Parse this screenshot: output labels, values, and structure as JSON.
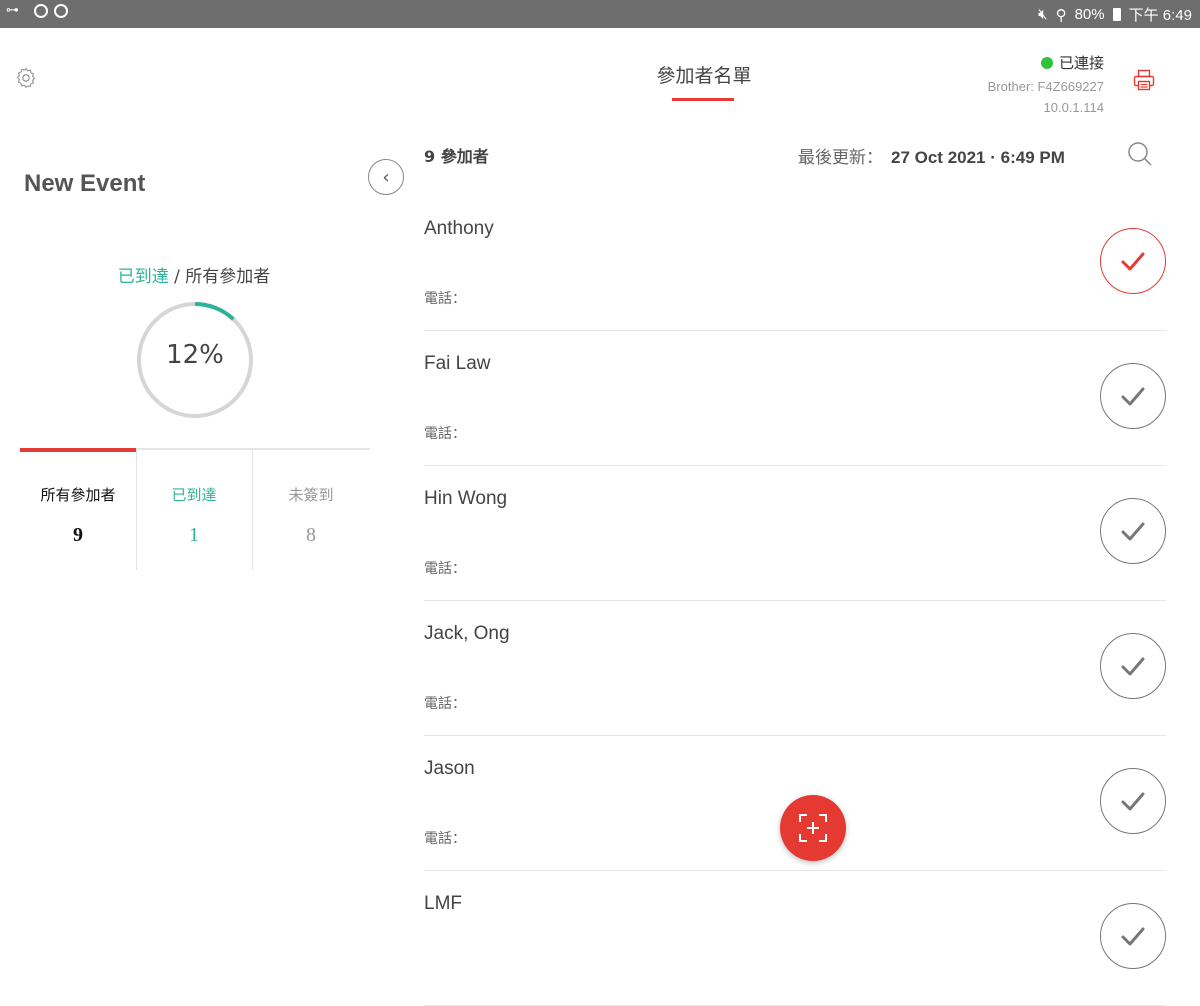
{
  "status_bar": {
    "battery": "80%",
    "time": "下午 6:49",
    "icons_left": [
      "key-icon",
      "vpn-icon",
      "minus-circle-icon"
    ],
    "icons_right": [
      "mute-icon",
      "signal-icon",
      "battery-icon"
    ]
  },
  "left_panel": {
    "event_title": "New Event",
    "ratio_label_arrived": "已到達",
    "ratio_label_sep": " / ",
    "ratio_label_all": "所有參加者",
    "progress_text": "12%",
    "progress_value": 0.12,
    "stats": [
      {
        "label": "所有參加者",
        "value": "9",
        "color": "#111111",
        "active": true
      },
      {
        "label": "已到達",
        "value": "1",
        "color": "#2bb39a",
        "active": false
      },
      {
        "label": "未簽到",
        "value": "8",
        "color": "#999999",
        "active": false
      }
    ]
  },
  "header": {
    "title": "參加者名單",
    "connection_status": "已連接",
    "printer_name": "Brother: F4Z669227",
    "printer_ip": "10.0.1.114"
  },
  "list_header": {
    "count_text": "9  參加者",
    "updated_label": "最後更新：",
    "updated_value": "27 Oct 2021 · 6:49 PM"
  },
  "attendees": [
    {
      "name": "Anthony",
      "phone_label": "電話：",
      "checked_in": true
    },
    {
      "name": "Fai Law",
      "phone_label": "電話：",
      "checked_in": false
    },
    {
      "name": "Hin Wong",
      "phone_label": "電話：",
      "checked_in": false
    },
    {
      "name": "Jack, Ong",
      "phone_label": "電話：",
      "checked_in": false
    },
    {
      "name": "Jason",
      "phone_label": "電話：",
      "checked_in": false
    },
    {
      "name": "LMF",
      "phone_label": "",
      "checked_in": false
    }
  ],
  "colors": {
    "accent": "#e53a32",
    "arrived": "#2bb39a",
    "connected": "#2fc23a"
  }
}
